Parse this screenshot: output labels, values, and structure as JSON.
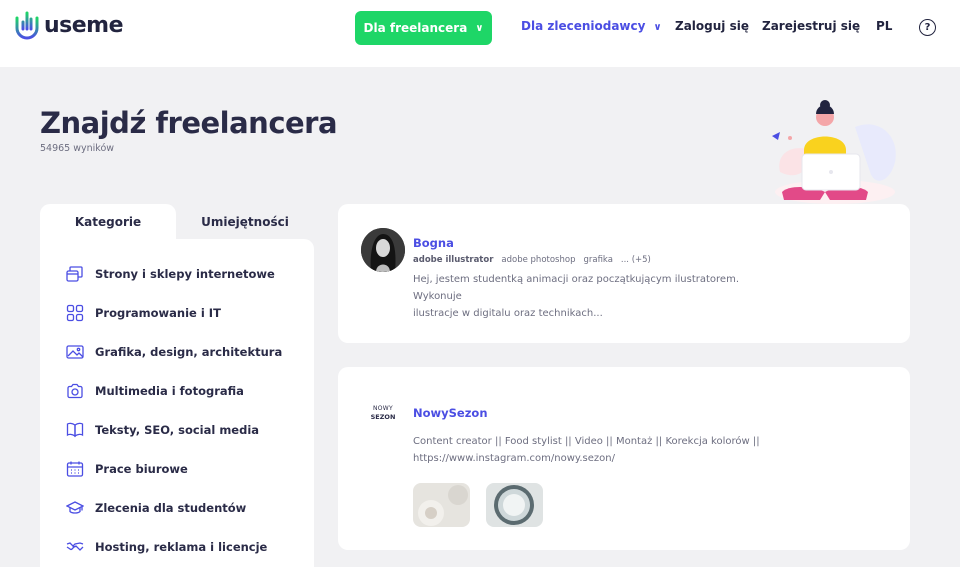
{
  "header": {
    "logo_text": "useme",
    "freelancer_button": "Dla freelancera",
    "clients_menu": "Dla zleceniodawcy",
    "login": "Zaloguj się",
    "register": "Zarejestruj się",
    "language": "PL",
    "help_symbol": "?"
  },
  "page": {
    "title": "Znajdź freelancera",
    "results": "54965 wyników"
  },
  "sidebar": {
    "tabs": [
      "Kategorie",
      "Umiejętności"
    ],
    "categories": [
      {
        "label": "Strony i sklepy internetowe",
        "icon": "web-pages-icon"
      },
      {
        "label": "Programowanie i IT",
        "icon": "programming-icon"
      },
      {
        "label": "Grafika, design, architektura",
        "icon": "graphics-icon"
      },
      {
        "label": "Multimedia i fotografia",
        "icon": "camera-icon"
      },
      {
        "label": "Teksty, SEO, social media",
        "icon": "book-icon"
      },
      {
        "label": "Prace biurowe",
        "icon": "calendar-icon"
      },
      {
        "label": "Zlecenia dla studentów",
        "icon": "graduation-cap-icon"
      },
      {
        "label": "Hosting, reklama i licencje",
        "icon": "handshake-icon"
      }
    ]
  },
  "freelancers": [
    {
      "name": "Bogna",
      "tags": [
        "adobe illustrator",
        "adobe photoshop",
        "grafika",
        "... (+5)"
      ],
      "description_line1": "Hej, jestem studentką animacji oraz początkującym ilustratorem. Wykonuje",
      "description_line2": "ilustracje w digitalu oraz technikach..."
    },
    {
      "name": "NowySezon",
      "logo_line1": "NOWY",
      "logo_line2": "SEZON",
      "description_line1": "Content creator || Food stylist || Video || Montaż || Korekcja kolorów ||",
      "description_line2": "https://www.instagram.com/nowy.sezon/"
    }
  ],
  "colors": {
    "accent_green": "#1ed667",
    "accent_blue": "#4b4ee3",
    "text_dark": "#2a2b47",
    "background": "#f1f1f3"
  }
}
